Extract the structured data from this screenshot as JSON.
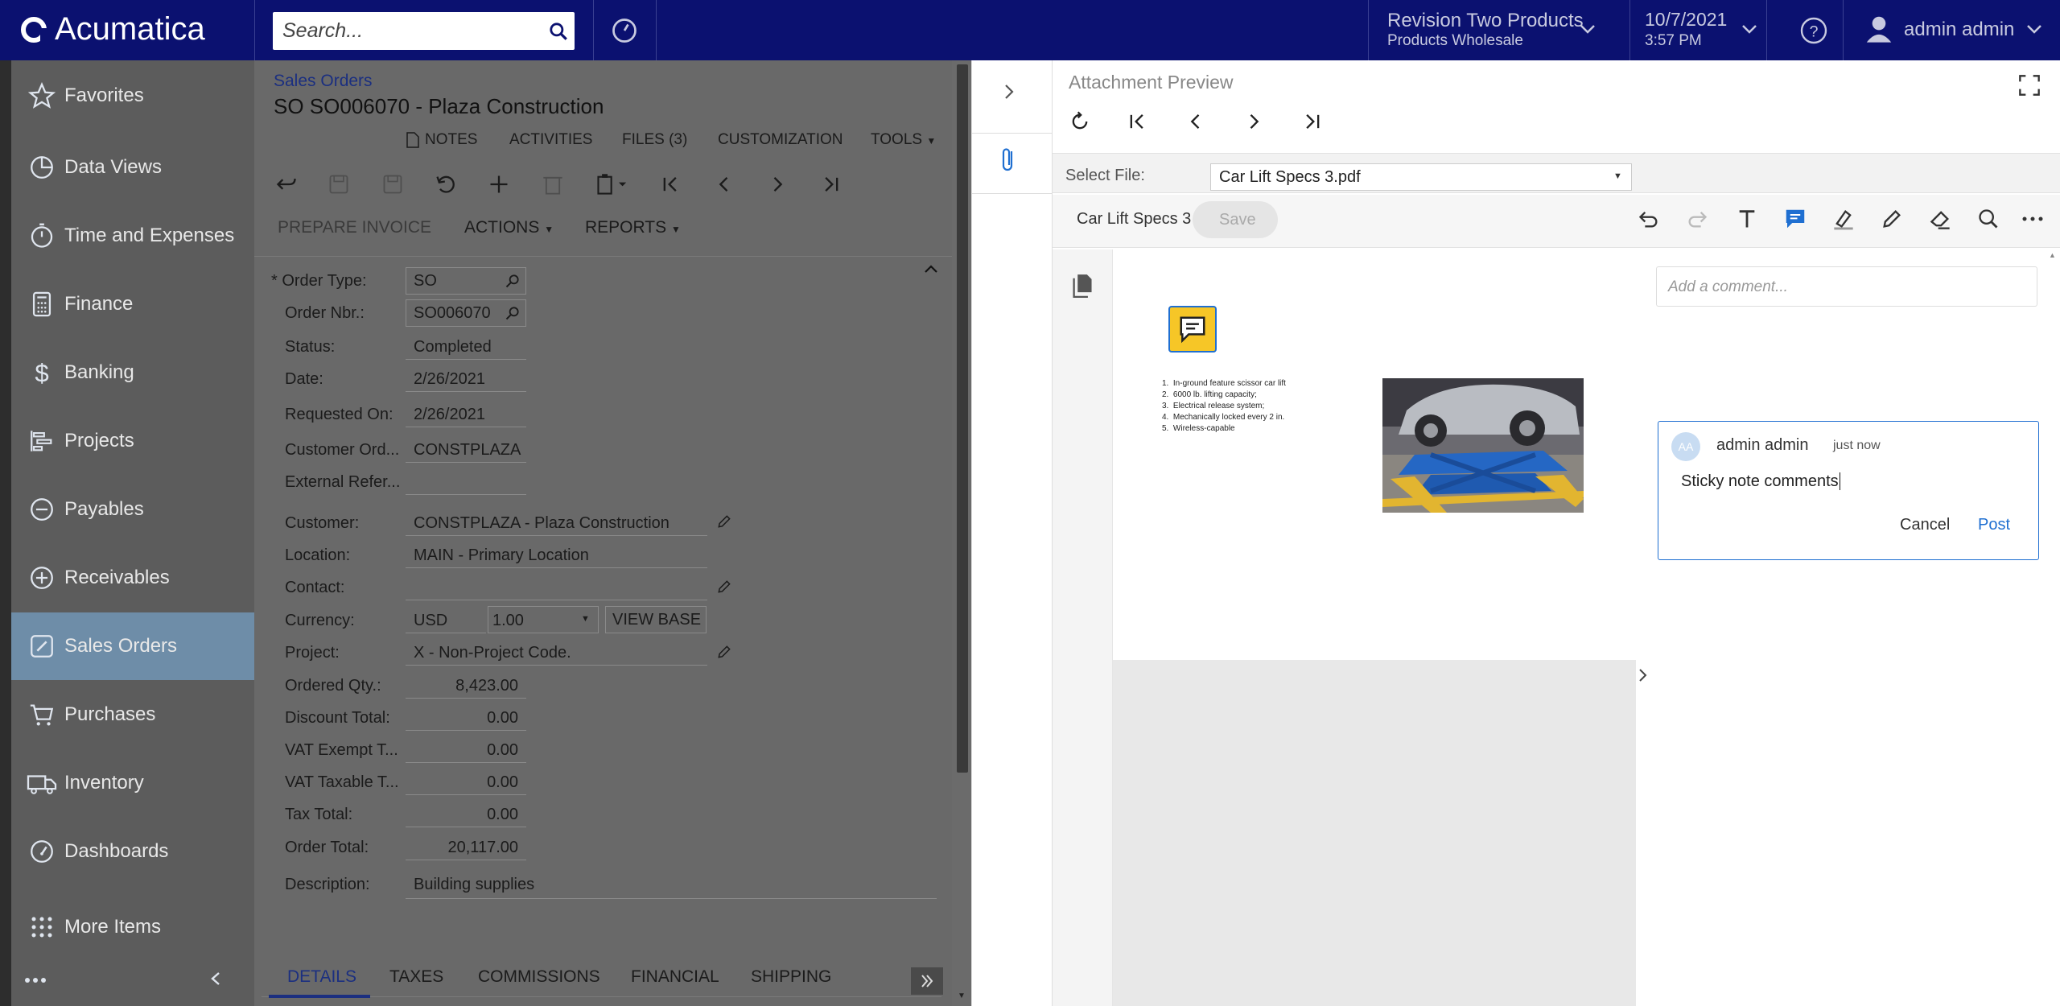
{
  "app": {
    "name": "Acumatica",
    "search_placeholder": "Search..."
  },
  "company": {
    "name": "Revision Two Products",
    "branch": "Products Wholesale"
  },
  "datetime": {
    "date": "10/7/2021",
    "time": "3:57 PM"
  },
  "user": {
    "name": "admin admin"
  },
  "sidebar": {
    "items": [
      {
        "label": "Favorites",
        "icon": "star-icon"
      },
      {
        "label": "Data Views",
        "icon": "pie-chart-icon"
      },
      {
        "label": "Time and Expenses",
        "icon": "stopwatch-icon"
      },
      {
        "label": "Finance",
        "icon": "calculator-icon"
      },
      {
        "label": "Banking",
        "icon": "dollar-icon"
      },
      {
        "label": "Projects",
        "icon": "projects-icon"
      },
      {
        "label": "Payables",
        "icon": "minus-circle-icon"
      },
      {
        "label": "Receivables",
        "icon": "plus-circle-icon"
      },
      {
        "label": "Sales Orders",
        "icon": "edit-icon"
      },
      {
        "label": "Purchases",
        "icon": "cart-icon"
      },
      {
        "label": "Inventory",
        "icon": "truck-icon"
      },
      {
        "label": "Dashboards",
        "icon": "gauge-icon"
      },
      {
        "label": "More Items",
        "icon": "grid-icon"
      }
    ]
  },
  "form": {
    "breadcrumb": "Sales Orders",
    "title": "SO SO006070 - Plaza Construction",
    "links": {
      "notes": "NOTES",
      "activities": "ACTIVITIES",
      "files": "FILES (3)",
      "customization": "CUSTOMIZATION",
      "tools": "TOOLS"
    },
    "actions": {
      "prepare_invoice": "PREPARE INVOICE",
      "actions": "ACTIONS",
      "reports": "REPORTS"
    },
    "fields": {
      "order_type_label": "Order Type:",
      "order_type": "SO",
      "order_nbr_label": "Order Nbr.:",
      "order_nbr": "SO006070",
      "status_label": "Status:",
      "status": "Completed",
      "date_label": "Date:",
      "date": "2/26/2021",
      "requested_on_label": "Requested On:",
      "requested_on": "2/26/2021",
      "customer_ord_label": "Customer Ord...",
      "customer_ord": "CONSTPLAZA",
      "external_ref_label": "External Refer...",
      "customer_label": "Customer:",
      "customer": "CONSTPLAZA - Plaza Construction",
      "location_label": "Location:",
      "location": "MAIN - Primary Location",
      "contact_label": "Contact:",
      "currency_label": "Currency:",
      "currency": "USD",
      "rate": "1.00",
      "view_base": "VIEW BASE",
      "project_label": "Project:",
      "project": "X - Non-Project Code.",
      "ordered_qty_label": "Ordered Qty.:",
      "ordered_qty": "8,423.00",
      "discount_total_label": "Discount Total:",
      "discount_total": "0.00",
      "vat_exempt_label": "VAT Exempt T...",
      "vat_exempt": "0.00",
      "vat_taxable_label": "VAT Taxable T...",
      "vat_taxable": "0.00",
      "tax_total_label": "Tax Total:",
      "tax_total": "0.00",
      "order_total_label": "Order Total:",
      "order_total": "20,117.00",
      "description_label": "Description:",
      "description": "Building supplies"
    },
    "tabs": [
      "DETAILS",
      "TAXES",
      "COMMISSIONS",
      "FINANCIAL",
      "SHIPPING"
    ]
  },
  "attachment": {
    "title": "Attachment Preview",
    "select_file_label": "Select File:",
    "selected_file": "Car Lift Specs 3.pdf",
    "doc_name": "Car Lift Specs 3",
    "save": "Save",
    "comment_placeholder": "Add a comment...",
    "pdf_list": [
      "In-ground feature scissor car lift",
      "6000 lb. lifting capacity;",
      "Electrical release system;",
      "Mechanically locked every 2 in.",
      "Wireless-capable"
    ],
    "comment": {
      "initials": "AA",
      "author": "admin admin",
      "time": "just now",
      "text": "Sticky note comments",
      "cancel": "Cancel",
      "post": "Post"
    }
  }
}
